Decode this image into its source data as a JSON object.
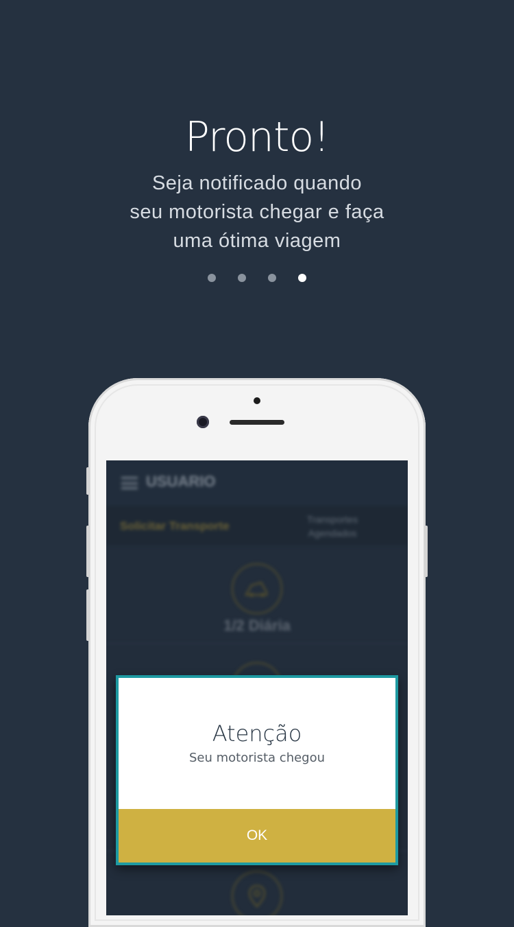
{
  "onboarding": {
    "title": "Pronto!",
    "subtitle_lines": [
      "Seja notificado quando",
      "seu motorista chegar e faça",
      "uma ótima viagem"
    ],
    "page_indicator": {
      "total": 4,
      "active": 4
    }
  },
  "app_preview": {
    "header_title": "USUARIO",
    "tabs": [
      "Solicitar Transporte",
      "Transportes Agendados"
    ],
    "cards": [
      {
        "label": "1/2 Diária",
        "icon": "car-icon"
      },
      {
        "label": "",
        "icon": "clock-icon"
      },
      {
        "label": "",
        "icon": "location-pin-icon"
      }
    ]
  },
  "dialog": {
    "title": "Atenção",
    "message": "Seu motorista chegou",
    "ok_label": "OK"
  },
  "colors": {
    "background": "#253140",
    "accent_gold": "#cfb142",
    "dialog_border": "#1e9aa2"
  }
}
